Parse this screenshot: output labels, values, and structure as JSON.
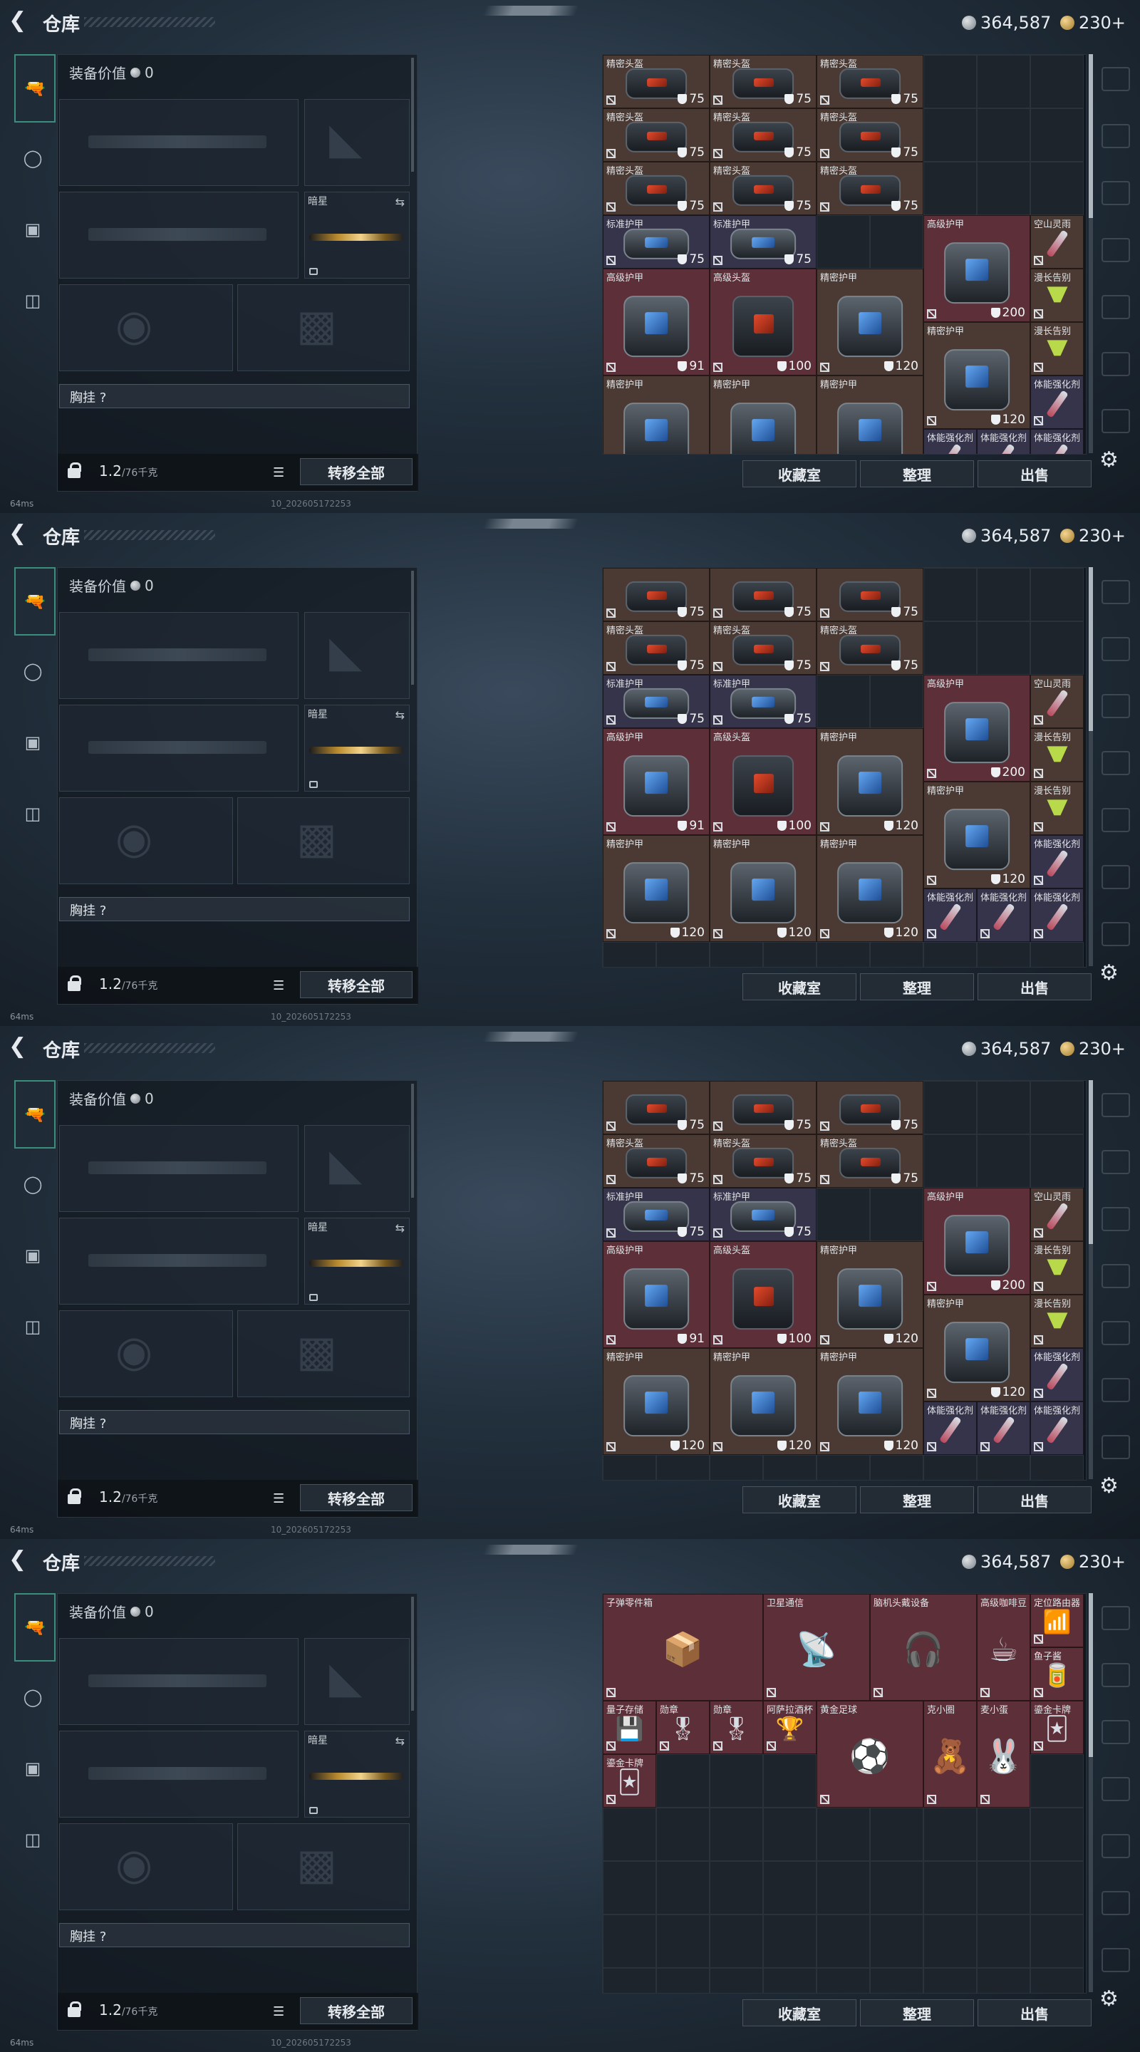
{
  "header": {
    "title": "仓库",
    "silver": "364,587",
    "gold": "230+"
  },
  "loadout": {
    "equipment_value_label": "装备价值",
    "equipment_value": "0",
    "secondary_label": "暗星",
    "chest_rig_label": "胸挂 ?",
    "weight": "1.2",
    "weight_max": "/76千克",
    "transfer_all": "转移全部"
  },
  "actions": {
    "collection": "收藏室",
    "sort": "整理",
    "sell": "出售"
  },
  "status": {
    "ping": "64ms",
    "build": "10_202605172253"
  },
  "icons": {
    "back": "back-arrow-icon",
    "settings": "gear-icon"
  },
  "colors": {
    "brown_rarity": "#4a3a33",
    "purple_rarity": "#35344a",
    "red_rarity": "#5d2f38",
    "accent": "#3b8e7c"
  },
  "panels": [
    {
      "cells": [
        {
          "name": "精密头盔",
          "val": "75",
          "c": 0,
          "r": 0,
          "w": 2,
          "h": 1,
          "t": "brown",
          "i": "helmet"
        },
        {
          "name": "精密头盔",
          "val": "75",
          "c": 2,
          "r": 0,
          "w": 2,
          "h": 1,
          "t": "brown",
          "i": "helmet"
        },
        {
          "name": "精密头盔",
          "val": "75",
          "c": 4,
          "r": 0,
          "w": 2,
          "h": 1,
          "t": "brown",
          "i": "helmet"
        },
        {
          "name": "精密头盔",
          "val": "75",
          "c": 0,
          "r": 1,
          "w": 2,
          "h": 1,
          "t": "brown",
          "i": "helmet"
        },
        {
          "name": "精密头盔",
          "val": "75",
          "c": 2,
          "r": 1,
          "w": 2,
          "h": 1,
          "t": "brown",
          "i": "helmet"
        },
        {
          "name": "精密头盔",
          "val": "75",
          "c": 4,
          "r": 1,
          "w": 2,
          "h": 1,
          "t": "brown",
          "i": "helmet"
        },
        {
          "name": "精密头盔",
          "val": "75",
          "c": 0,
          "r": 2,
          "w": 2,
          "h": 1,
          "t": "brown",
          "i": "helmet"
        },
        {
          "name": "精密头盔",
          "val": "75",
          "c": 2,
          "r": 2,
          "w": 2,
          "h": 1,
          "t": "brown",
          "i": "helmet"
        },
        {
          "name": "精密头盔",
          "val": "75",
          "c": 4,
          "r": 2,
          "w": 2,
          "h": 1,
          "t": "brown",
          "i": "helmet"
        },
        {
          "name": "标准护甲",
          "val": "75",
          "c": 0,
          "r": 3,
          "w": 2,
          "h": 1,
          "t": "purple",
          "i": "armor"
        },
        {
          "name": "标准护甲",
          "val": "75",
          "c": 2,
          "r": 3,
          "w": 2,
          "h": 1,
          "t": "purple",
          "i": "armor"
        },
        {
          "name": "高级护甲",
          "val": "200",
          "c": 6,
          "r": 3,
          "w": 2,
          "h": 2,
          "t": "red",
          "i": "armor"
        },
        {
          "name": "空山灵雨",
          "val": "",
          "c": 8,
          "r": 3,
          "w": 1,
          "h": 1,
          "t": "brown",
          "i": "vial"
        },
        {
          "name": "高级护甲",
          "val": "91",
          "c": 0,
          "r": 4,
          "w": 2,
          "h": 2,
          "t": "red",
          "i": "armor"
        },
        {
          "name": "高级头盔",
          "val": "100",
          "c": 2,
          "r": 4,
          "w": 2,
          "h": 2,
          "t": "red",
          "i": "helmet"
        },
        {
          "name": "精密护甲",
          "val": "120",
          "c": 4,
          "r": 4,
          "w": 2,
          "h": 2,
          "t": "brown",
          "i": "armor"
        },
        {
          "name": "漫长告别",
          "val": "",
          "c": 8,
          "r": 4,
          "w": 1,
          "h": 1,
          "t": "brown",
          "i": "cocktail"
        },
        {
          "name": "精密护甲",
          "val": "120",
          "c": 6,
          "r": 5,
          "w": 2,
          "h": 2,
          "t": "brown",
          "i": "armor"
        },
        {
          "name": "漫长告别",
          "val": "",
          "c": 8,
          "r": 5,
          "w": 1,
          "h": 1,
          "t": "brown",
          "i": "cocktail"
        },
        {
          "name": "精密护甲",
          "val": "",
          "c": 0,
          "r": 6,
          "w": 2,
          "h": 2,
          "t": "brown",
          "i": "armor"
        },
        {
          "name": "精密护甲",
          "val": "",
          "c": 2,
          "r": 6,
          "w": 2,
          "h": 2,
          "t": "brown",
          "i": "armor"
        },
        {
          "name": "精密护甲",
          "val": "",
          "c": 4,
          "r": 6,
          "w": 2,
          "h": 2,
          "t": "brown",
          "i": "armor"
        },
        {
          "name": "体能强化剂",
          "val": "",
          "c": 8,
          "r": 6,
          "w": 1,
          "h": 1,
          "t": "purple",
          "i": "vial"
        },
        {
          "name": "体能强化剂",
          "val": "",
          "c": 6,
          "r": 7,
          "w": 1,
          "h": 1,
          "t": "purple",
          "i": "vial"
        },
        {
          "name": "体能强化剂",
          "val": "",
          "c": 7,
          "r": 7,
          "w": 1,
          "h": 1,
          "t": "purple",
          "i": "vial"
        },
        {
          "name": "体能强化剂",
          "val": "",
          "c": 8,
          "r": 7,
          "w": 1,
          "h": 1,
          "t": "purple",
          "i": "vial"
        }
      ]
    },
    {
      "cells": [
        {
          "name": "",
          "val": "75",
          "c": 0,
          "r": 0,
          "w": 2,
          "h": 1,
          "t": "brown",
          "i": "helmet"
        },
        {
          "name": "",
          "val": "75",
          "c": 2,
          "r": 0,
          "w": 2,
          "h": 1,
          "t": "brown",
          "i": "helmet"
        },
        {
          "name": "",
          "val": "75",
          "c": 4,
          "r": 0,
          "w": 2,
          "h": 1,
          "t": "brown",
          "i": "helmet"
        },
        {
          "name": "精密头盔",
          "val": "75",
          "c": 0,
          "r": 1,
          "w": 2,
          "h": 1,
          "t": "brown",
          "i": "helmet"
        },
        {
          "name": "精密头盔",
          "val": "75",
          "c": 2,
          "r": 1,
          "w": 2,
          "h": 1,
          "t": "brown",
          "i": "helmet"
        },
        {
          "name": "精密头盔",
          "val": "75",
          "c": 4,
          "r": 1,
          "w": 2,
          "h": 1,
          "t": "brown",
          "i": "helmet"
        },
        {
          "name": "标准护甲",
          "val": "75",
          "c": 0,
          "r": 2,
          "w": 2,
          "h": 1,
          "t": "purple",
          "i": "armor"
        },
        {
          "name": "标准护甲",
          "val": "75",
          "c": 2,
          "r": 2,
          "w": 2,
          "h": 1,
          "t": "purple",
          "i": "armor"
        },
        {
          "name": "高级护甲",
          "val": "200",
          "c": 6,
          "r": 2,
          "w": 2,
          "h": 2,
          "t": "red",
          "i": "armor"
        },
        {
          "name": "空山灵雨",
          "val": "",
          "c": 8,
          "r": 2,
          "w": 1,
          "h": 1,
          "t": "brown",
          "i": "vial"
        },
        {
          "name": "高级护甲",
          "val": "91",
          "c": 0,
          "r": 3,
          "w": 2,
          "h": 2,
          "t": "red",
          "i": "armor"
        },
        {
          "name": "高级头盔",
          "val": "100",
          "c": 2,
          "r": 3,
          "w": 2,
          "h": 2,
          "t": "red",
          "i": "helmet"
        },
        {
          "name": "精密护甲",
          "val": "120",
          "c": 4,
          "r": 3,
          "w": 2,
          "h": 2,
          "t": "brown",
          "i": "armor"
        },
        {
          "name": "漫长告别",
          "val": "",
          "c": 8,
          "r": 3,
          "w": 1,
          "h": 1,
          "t": "brown",
          "i": "cocktail"
        },
        {
          "name": "精密护甲",
          "val": "120",
          "c": 6,
          "r": 4,
          "w": 2,
          "h": 2,
          "t": "brown",
          "i": "armor"
        },
        {
          "name": "漫长告别",
          "val": "",
          "c": 8,
          "r": 4,
          "w": 1,
          "h": 1,
          "t": "brown",
          "i": "cocktail"
        },
        {
          "name": "精密护甲",
          "val": "120",
          "c": 0,
          "r": 5,
          "w": 2,
          "h": 2,
          "t": "brown",
          "i": "armor"
        },
        {
          "name": "精密护甲",
          "val": "120",
          "c": 2,
          "r": 5,
          "w": 2,
          "h": 2,
          "t": "brown",
          "i": "armor"
        },
        {
          "name": "精密护甲",
          "val": "120",
          "c": 4,
          "r": 5,
          "w": 2,
          "h": 2,
          "t": "brown",
          "i": "armor"
        },
        {
          "name": "体能强化剂",
          "val": "",
          "c": 8,
          "r": 5,
          "w": 1,
          "h": 1,
          "t": "purple",
          "i": "vial"
        },
        {
          "name": "体能强化剂",
          "val": "",
          "c": 6,
          "r": 6,
          "w": 1,
          "h": 1,
          "t": "purple",
          "i": "vial"
        },
        {
          "name": "体能强化剂",
          "val": "",
          "c": 7,
          "r": 6,
          "w": 1,
          "h": 1,
          "t": "purple",
          "i": "vial"
        },
        {
          "name": "体能强化剂",
          "val": "",
          "c": 8,
          "r": 6,
          "w": 1,
          "h": 1,
          "t": "purple",
          "i": "vial"
        }
      ]
    },
    {
      "cells": [
        {
          "name": "",
          "val": "75",
          "c": 0,
          "r": 0,
          "w": 2,
          "h": 1,
          "t": "brown",
          "i": "helmet"
        },
        {
          "name": "",
          "val": "75",
          "c": 2,
          "r": 0,
          "w": 2,
          "h": 1,
          "t": "brown",
          "i": "helmet"
        },
        {
          "name": "",
          "val": "75",
          "c": 4,
          "r": 0,
          "w": 2,
          "h": 1,
          "t": "brown",
          "i": "helmet"
        },
        {
          "name": "精密头盔",
          "val": "75",
          "c": 0,
          "r": 1,
          "w": 2,
          "h": 1,
          "t": "brown",
          "i": "helmet"
        },
        {
          "name": "精密头盔",
          "val": "75",
          "c": 2,
          "r": 1,
          "w": 2,
          "h": 1,
          "t": "brown",
          "i": "helmet"
        },
        {
          "name": "精密头盔",
          "val": "75",
          "c": 4,
          "r": 1,
          "w": 2,
          "h": 1,
          "t": "brown",
          "i": "helmet"
        },
        {
          "name": "标准护甲",
          "val": "75",
          "c": 0,
          "r": 2,
          "w": 2,
          "h": 1,
          "t": "purple",
          "i": "armor"
        },
        {
          "name": "标准护甲",
          "val": "75",
          "c": 2,
          "r": 2,
          "w": 2,
          "h": 1,
          "t": "purple",
          "i": "armor"
        },
        {
          "name": "高级护甲",
          "val": "200",
          "c": 6,
          "r": 2,
          "w": 2,
          "h": 2,
          "t": "red",
          "i": "armor"
        },
        {
          "name": "空山灵雨",
          "val": "",
          "c": 8,
          "r": 2,
          "w": 1,
          "h": 1,
          "t": "brown",
          "i": "vial"
        },
        {
          "name": "高级护甲",
          "val": "91",
          "c": 0,
          "r": 3,
          "w": 2,
          "h": 2,
          "t": "red",
          "i": "armor"
        },
        {
          "name": "高级头盔",
          "val": "100",
          "c": 2,
          "r": 3,
          "w": 2,
          "h": 2,
          "t": "red",
          "i": "helmet"
        },
        {
          "name": "精密护甲",
          "val": "120",
          "c": 4,
          "r": 3,
          "w": 2,
          "h": 2,
          "t": "brown",
          "i": "armor"
        },
        {
          "name": "漫长告别",
          "val": "",
          "c": 8,
          "r": 3,
          "w": 1,
          "h": 1,
          "t": "brown",
          "i": "cocktail"
        },
        {
          "name": "精密护甲",
          "val": "120",
          "c": 6,
          "r": 4,
          "w": 2,
          "h": 2,
          "t": "brown",
          "i": "armor"
        },
        {
          "name": "漫长告别",
          "val": "",
          "c": 8,
          "r": 4,
          "w": 1,
          "h": 1,
          "t": "brown",
          "i": "cocktail"
        },
        {
          "name": "精密护甲",
          "val": "120",
          "c": 0,
          "r": 5,
          "w": 2,
          "h": 2,
          "t": "brown",
          "i": "armor"
        },
        {
          "name": "精密护甲",
          "val": "120",
          "c": 2,
          "r": 5,
          "w": 2,
          "h": 2,
          "t": "brown",
          "i": "armor"
        },
        {
          "name": "精密护甲",
          "val": "120",
          "c": 4,
          "r": 5,
          "w": 2,
          "h": 2,
          "t": "brown",
          "i": "armor"
        },
        {
          "name": "体能强化剂",
          "val": "",
          "c": 8,
          "r": 5,
          "w": 1,
          "h": 1,
          "t": "purple",
          "i": "vial"
        },
        {
          "name": "体能强化剂",
          "val": "",
          "c": 6,
          "r": 6,
          "w": 1,
          "h": 1,
          "t": "purple",
          "i": "vial"
        },
        {
          "name": "体能强化剂",
          "val": "",
          "c": 7,
          "r": 6,
          "w": 1,
          "h": 1,
          "t": "purple",
          "i": "vial"
        },
        {
          "name": "体能强化剂",
          "val": "",
          "c": 8,
          "r": 6,
          "w": 1,
          "h": 1,
          "t": "purple",
          "i": "vial"
        }
      ]
    },
    {
      "cells": [
        {
          "name": "子弹零件箱",
          "val": "",
          "c": 0,
          "r": 0,
          "w": 3,
          "h": 2,
          "t": "red",
          "i": "box"
        },
        {
          "name": "卫星通信",
          "val": "",
          "c": 3,
          "r": 0,
          "w": 2,
          "h": 2,
          "t": "red",
          "i": "dish"
        },
        {
          "name": "脑机头戴设备",
          "val": "",
          "c": 5,
          "r": 0,
          "w": 2,
          "h": 2,
          "t": "red",
          "i": "headset"
        },
        {
          "name": "高级咖啡豆",
          "val": "",
          "c": 7,
          "r": 0,
          "w": 1,
          "h": 2,
          "t": "red",
          "i": "coffee"
        },
        {
          "name": "定位路由器",
          "val": "",
          "c": 8,
          "r": 0,
          "w": 1,
          "h": 1,
          "t": "red",
          "i": "router"
        },
        {
          "name": "鱼子酱",
          "val": "",
          "c": 8,
          "r": 1,
          "w": 1,
          "h": 1,
          "t": "red",
          "i": "can"
        },
        {
          "name": "量子存储",
          "val": "",
          "c": 0,
          "r": 2,
          "w": 1,
          "h": 1,
          "t": "red",
          "i": "chip"
        },
        {
          "name": "勋章",
          "val": "",
          "c": 1,
          "r": 2,
          "w": 1,
          "h": 1,
          "t": "red",
          "i": "medal"
        },
        {
          "name": "勋章",
          "val": "",
          "c": 2,
          "r": 2,
          "w": 1,
          "h": 1,
          "t": "red",
          "i": "medal"
        },
        {
          "name": "阿萨拉酒杯",
          "val": "",
          "c": 3,
          "r": 2,
          "w": 1,
          "h": 1,
          "t": "red",
          "i": "cup"
        },
        {
          "name": "黄金足球",
          "val": "",
          "c": 4,
          "r": 2,
          "w": 2,
          "h": 2,
          "t": "red",
          "i": "ball"
        },
        {
          "name": "克小圈",
          "val": "",
          "c": 6,
          "r": 2,
          "w": 1,
          "h": 2,
          "t": "red",
          "i": "toy"
        },
        {
          "name": "麦小蛋",
          "val": "",
          "c": 7,
          "r": 2,
          "w": 1,
          "h": 2,
          "t": "red",
          "i": "toy2"
        },
        {
          "name": "鎏金卡牌",
          "val": "",
          "c": 8,
          "r": 2,
          "w": 1,
          "h": 1,
          "t": "red",
          "i": "card"
        },
        {
          "name": "鎏金卡牌",
          "val": "",
          "c": 0,
          "r": 3,
          "w": 1,
          "h": 1,
          "t": "red",
          "i": "card"
        }
      ]
    }
  ]
}
